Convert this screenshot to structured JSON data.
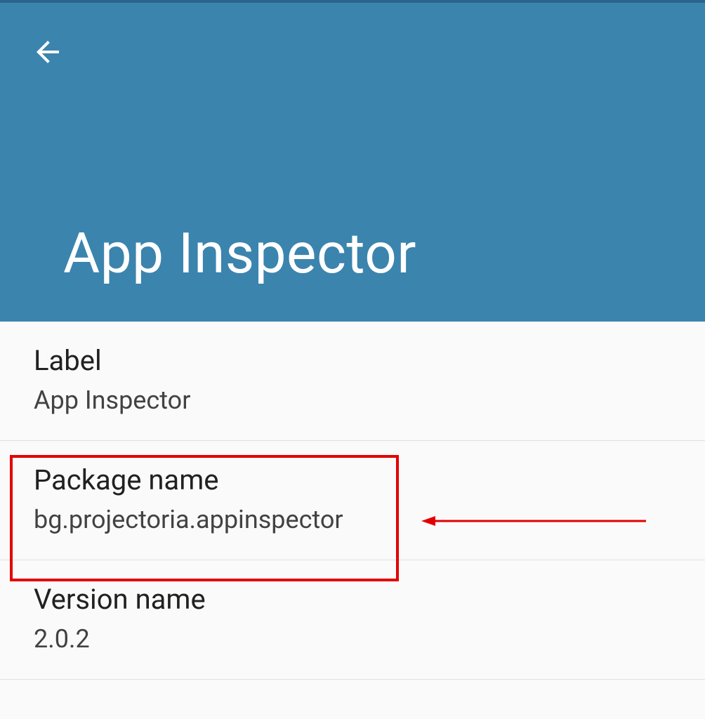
{
  "header": {
    "title": "App Inspector"
  },
  "details": {
    "label": {
      "title": "Label",
      "value": "App Inspector"
    },
    "package_name": {
      "title": "Package name",
      "value": "bg.projectoria.appinspector"
    },
    "version_name": {
      "title": "Version name",
      "value": "2.0.2"
    }
  },
  "annotation": {
    "highlight_target": "package-name",
    "highlight_color": "#e30000"
  }
}
